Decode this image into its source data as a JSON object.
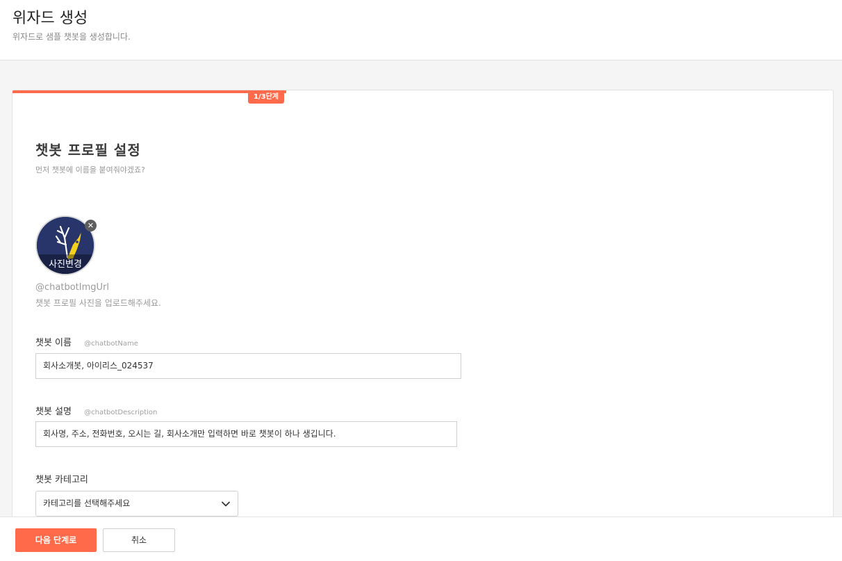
{
  "header": {
    "title": "위자드 생성",
    "subtitle": "위자드로 샘플 챗봇을 생성합니다."
  },
  "progress": {
    "step_label": "1/3단계",
    "fraction": 0.3333
  },
  "profile": {
    "title": "챗봇 프로필 설정",
    "description": "먼저 챗봇에 이름을 붙여줘야겠죠?",
    "avatar_change_label": "사진변경",
    "img_variable": "@chatbotImgUrl",
    "img_help": "챗봇 프로필 사진을 업로드해주세요."
  },
  "fields": {
    "name": {
      "label": "챗봇 이름",
      "variable": "@chatbotName",
      "value": "회사소개봇, 아이리스_024537"
    },
    "description": {
      "label": "챗봇 설명",
      "variable": "@chatbotDescription",
      "value": "회사명, 주소, 전화번호, 오시는 길, 회사소개만 입력하면 바로 챗봇이 하나 생깁니다."
    },
    "category": {
      "label": "챗봇 카테고리",
      "placeholder": "카테고리를 선택해주세요"
    }
  },
  "footer": {
    "next_label": "다음 단계로",
    "cancel_label": "취소"
  },
  "colors": {
    "accent": "#ff6b4a",
    "avatar_bg": "#27356b",
    "mascot": "#f2d21f"
  },
  "icons": {
    "remove": "close-icon",
    "select": "chevron-down-icon"
  }
}
